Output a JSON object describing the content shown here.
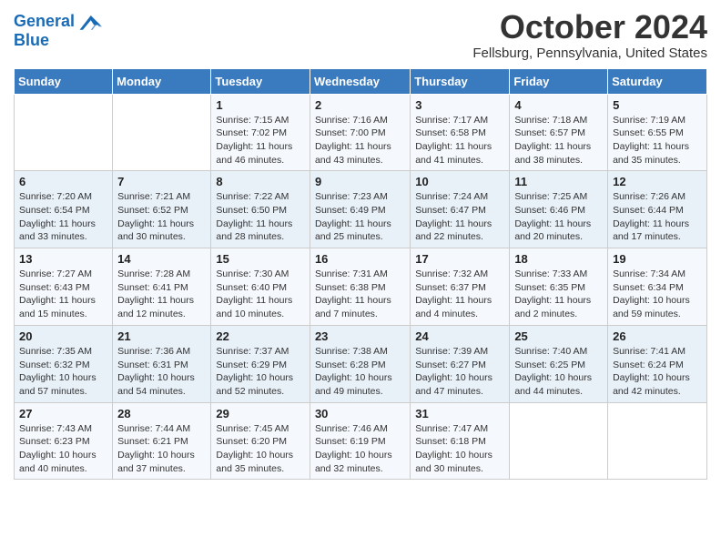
{
  "header": {
    "logo_line1": "General",
    "logo_line2": "Blue",
    "month_title": "October 2024",
    "location": "Fellsburg, Pennsylvania, United States"
  },
  "days_of_week": [
    "Sunday",
    "Monday",
    "Tuesday",
    "Wednesday",
    "Thursday",
    "Friday",
    "Saturday"
  ],
  "weeks": [
    [
      {
        "num": "",
        "info": ""
      },
      {
        "num": "",
        "info": ""
      },
      {
        "num": "1",
        "info": "Sunrise: 7:15 AM\nSunset: 7:02 PM\nDaylight: 11 hours and 46 minutes."
      },
      {
        "num": "2",
        "info": "Sunrise: 7:16 AM\nSunset: 7:00 PM\nDaylight: 11 hours and 43 minutes."
      },
      {
        "num": "3",
        "info": "Sunrise: 7:17 AM\nSunset: 6:58 PM\nDaylight: 11 hours and 41 minutes."
      },
      {
        "num": "4",
        "info": "Sunrise: 7:18 AM\nSunset: 6:57 PM\nDaylight: 11 hours and 38 minutes."
      },
      {
        "num": "5",
        "info": "Sunrise: 7:19 AM\nSunset: 6:55 PM\nDaylight: 11 hours and 35 minutes."
      }
    ],
    [
      {
        "num": "6",
        "info": "Sunrise: 7:20 AM\nSunset: 6:54 PM\nDaylight: 11 hours and 33 minutes."
      },
      {
        "num": "7",
        "info": "Sunrise: 7:21 AM\nSunset: 6:52 PM\nDaylight: 11 hours and 30 minutes."
      },
      {
        "num": "8",
        "info": "Sunrise: 7:22 AM\nSunset: 6:50 PM\nDaylight: 11 hours and 28 minutes."
      },
      {
        "num": "9",
        "info": "Sunrise: 7:23 AM\nSunset: 6:49 PM\nDaylight: 11 hours and 25 minutes."
      },
      {
        "num": "10",
        "info": "Sunrise: 7:24 AM\nSunset: 6:47 PM\nDaylight: 11 hours and 22 minutes."
      },
      {
        "num": "11",
        "info": "Sunrise: 7:25 AM\nSunset: 6:46 PM\nDaylight: 11 hours and 20 minutes."
      },
      {
        "num": "12",
        "info": "Sunrise: 7:26 AM\nSunset: 6:44 PM\nDaylight: 11 hours and 17 minutes."
      }
    ],
    [
      {
        "num": "13",
        "info": "Sunrise: 7:27 AM\nSunset: 6:43 PM\nDaylight: 11 hours and 15 minutes."
      },
      {
        "num": "14",
        "info": "Sunrise: 7:28 AM\nSunset: 6:41 PM\nDaylight: 11 hours and 12 minutes."
      },
      {
        "num": "15",
        "info": "Sunrise: 7:30 AM\nSunset: 6:40 PM\nDaylight: 11 hours and 10 minutes."
      },
      {
        "num": "16",
        "info": "Sunrise: 7:31 AM\nSunset: 6:38 PM\nDaylight: 11 hours and 7 minutes."
      },
      {
        "num": "17",
        "info": "Sunrise: 7:32 AM\nSunset: 6:37 PM\nDaylight: 11 hours and 4 minutes."
      },
      {
        "num": "18",
        "info": "Sunrise: 7:33 AM\nSunset: 6:35 PM\nDaylight: 11 hours and 2 minutes."
      },
      {
        "num": "19",
        "info": "Sunrise: 7:34 AM\nSunset: 6:34 PM\nDaylight: 10 hours and 59 minutes."
      }
    ],
    [
      {
        "num": "20",
        "info": "Sunrise: 7:35 AM\nSunset: 6:32 PM\nDaylight: 10 hours and 57 minutes."
      },
      {
        "num": "21",
        "info": "Sunrise: 7:36 AM\nSunset: 6:31 PM\nDaylight: 10 hours and 54 minutes."
      },
      {
        "num": "22",
        "info": "Sunrise: 7:37 AM\nSunset: 6:29 PM\nDaylight: 10 hours and 52 minutes."
      },
      {
        "num": "23",
        "info": "Sunrise: 7:38 AM\nSunset: 6:28 PM\nDaylight: 10 hours and 49 minutes."
      },
      {
        "num": "24",
        "info": "Sunrise: 7:39 AM\nSunset: 6:27 PM\nDaylight: 10 hours and 47 minutes."
      },
      {
        "num": "25",
        "info": "Sunrise: 7:40 AM\nSunset: 6:25 PM\nDaylight: 10 hours and 44 minutes."
      },
      {
        "num": "26",
        "info": "Sunrise: 7:41 AM\nSunset: 6:24 PM\nDaylight: 10 hours and 42 minutes."
      }
    ],
    [
      {
        "num": "27",
        "info": "Sunrise: 7:43 AM\nSunset: 6:23 PM\nDaylight: 10 hours and 40 minutes."
      },
      {
        "num": "28",
        "info": "Sunrise: 7:44 AM\nSunset: 6:21 PM\nDaylight: 10 hours and 37 minutes."
      },
      {
        "num": "29",
        "info": "Sunrise: 7:45 AM\nSunset: 6:20 PM\nDaylight: 10 hours and 35 minutes."
      },
      {
        "num": "30",
        "info": "Sunrise: 7:46 AM\nSunset: 6:19 PM\nDaylight: 10 hours and 32 minutes."
      },
      {
        "num": "31",
        "info": "Sunrise: 7:47 AM\nSunset: 6:18 PM\nDaylight: 10 hours and 30 minutes."
      },
      {
        "num": "",
        "info": ""
      },
      {
        "num": "",
        "info": ""
      }
    ]
  ]
}
